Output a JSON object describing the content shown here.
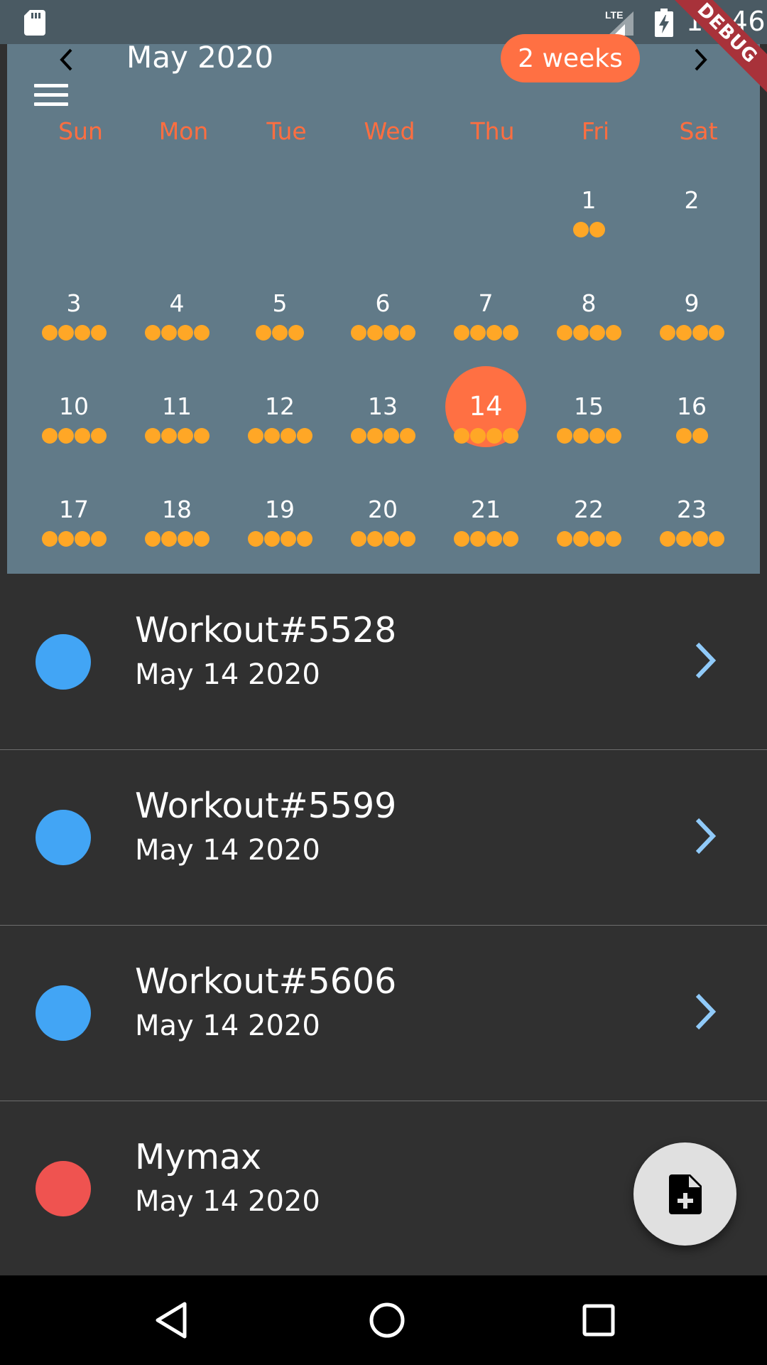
{
  "status_bar": {
    "time": "11:46",
    "network": "LTE",
    "icons": [
      "sd-card-icon",
      "lte-signal-icon",
      "battery-charging-icon"
    ]
  },
  "debug_banner": "DEBUG",
  "calendar": {
    "month_label": "May 2020",
    "format_button": "2 weeks",
    "weekdays": [
      "Sun",
      "Mon",
      "Tue",
      "Wed",
      "Thu",
      "Fri",
      "Sat"
    ],
    "selected_day": "14",
    "weeks": [
      [
        {
          "day": "",
          "events": 0
        },
        {
          "day": "",
          "events": 0
        },
        {
          "day": "",
          "events": 0
        },
        {
          "day": "",
          "events": 0
        },
        {
          "day": "",
          "events": 0
        },
        {
          "day": "1",
          "events": 2
        },
        {
          "day": "2",
          "events": 0
        }
      ],
      [
        {
          "day": "3",
          "events": 4
        },
        {
          "day": "4",
          "events": 4
        },
        {
          "day": "5",
          "events": 3
        },
        {
          "day": "6",
          "events": 4
        },
        {
          "day": "7",
          "events": 4
        },
        {
          "day": "8",
          "events": 4
        },
        {
          "day": "9",
          "events": 4
        }
      ],
      [
        {
          "day": "10",
          "events": 4
        },
        {
          "day": "11",
          "events": 4
        },
        {
          "day": "12",
          "events": 4
        },
        {
          "day": "13",
          "events": 4
        },
        {
          "day": "14",
          "events": 4
        },
        {
          "day": "15",
          "events": 4
        },
        {
          "day": "16",
          "events": 2
        }
      ],
      [
        {
          "day": "17",
          "events": 4
        },
        {
          "day": "18",
          "events": 4
        },
        {
          "day": "19",
          "events": 4
        },
        {
          "day": "20",
          "events": 4
        },
        {
          "day": "21",
          "events": 4
        },
        {
          "day": "22",
          "events": 4
        },
        {
          "day": "23",
          "events": 4
        }
      ]
    ]
  },
  "workouts": [
    {
      "title": "Workout#5528",
      "date": "May 14 2020",
      "color": "#42a5f5",
      "has_chevron": true
    },
    {
      "title": "Workout#5599",
      "date": "May 14 2020",
      "color": "#42a5f5",
      "has_chevron": true
    },
    {
      "title": "Workout#5606",
      "date": "May 14 2020",
      "color": "#42a5f5",
      "has_chevron": true
    },
    {
      "title": "Mymax",
      "date": "May 14 2020",
      "color": "#ef5350",
      "has_chevron": false
    }
  ],
  "fab": {
    "icon": "note-add-icon"
  },
  "nav_bar": {
    "icons": [
      "back-icon",
      "home-icon",
      "recents-icon"
    ]
  },
  "colors": {
    "calendar_bg": "#617a88",
    "accent": "#ff7043",
    "event_dot": "#ffa726",
    "list_bg": "#303030",
    "chevron": "#90caf9"
  }
}
